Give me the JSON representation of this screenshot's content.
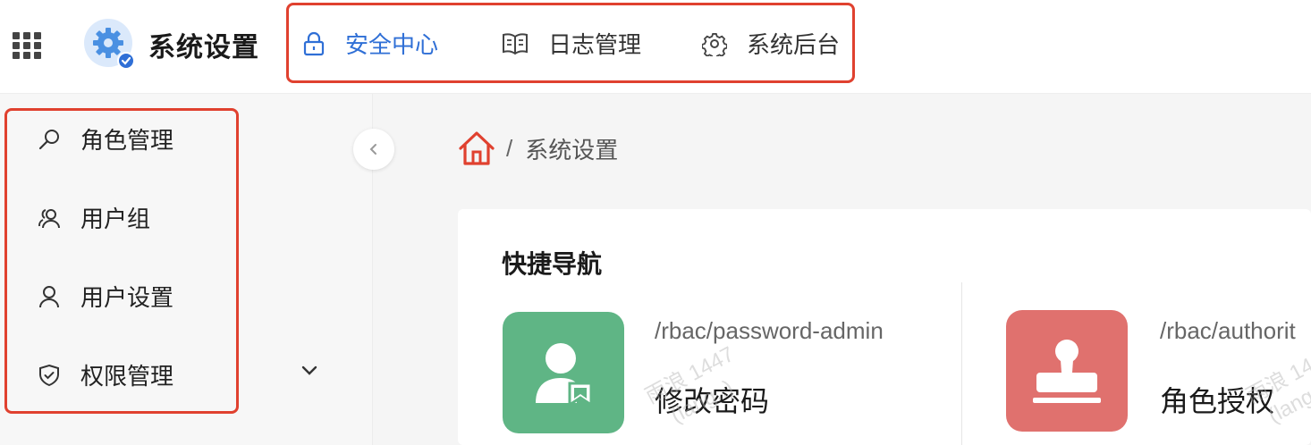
{
  "app": {
    "title": "系统设置"
  },
  "topnav": [
    {
      "label": "安全中心",
      "icon": "lock-icon",
      "active": true
    },
    {
      "label": "日志管理",
      "icon": "book-icon",
      "active": false
    },
    {
      "label": "系统后台",
      "icon": "gear-icon",
      "active": false
    }
  ],
  "sidebar": {
    "items": [
      {
        "label": "角色管理",
        "icon": "key-icon"
      },
      {
        "label": "用户组",
        "icon": "users-icon"
      },
      {
        "label": "用户设置",
        "icon": "user-icon"
      },
      {
        "label": "权限管理",
        "icon": "shield-icon",
        "expandable": true
      }
    ]
  },
  "breadcrumb": {
    "home_icon": "home-icon",
    "separator": "/",
    "current": "系统设置"
  },
  "quicknav": {
    "title": "快捷导航",
    "tiles": [
      {
        "path": "/rbac/password-admin",
        "name": "修改密码",
        "icon": "user-badge-icon",
        "color": "#5fb585"
      },
      {
        "path": "/rbac/authorit",
        "name": "角色授权",
        "icon": "stamp-icon",
        "color": "#e0716e"
      }
    ]
  },
  "watermark": {
    "line1": "雨浪 1447",
    "line2": "(lang..)"
  },
  "colors": {
    "accent": "#2f6fd6",
    "highlight_border": "#e0412f",
    "home_icon": "#e0412f"
  }
}
